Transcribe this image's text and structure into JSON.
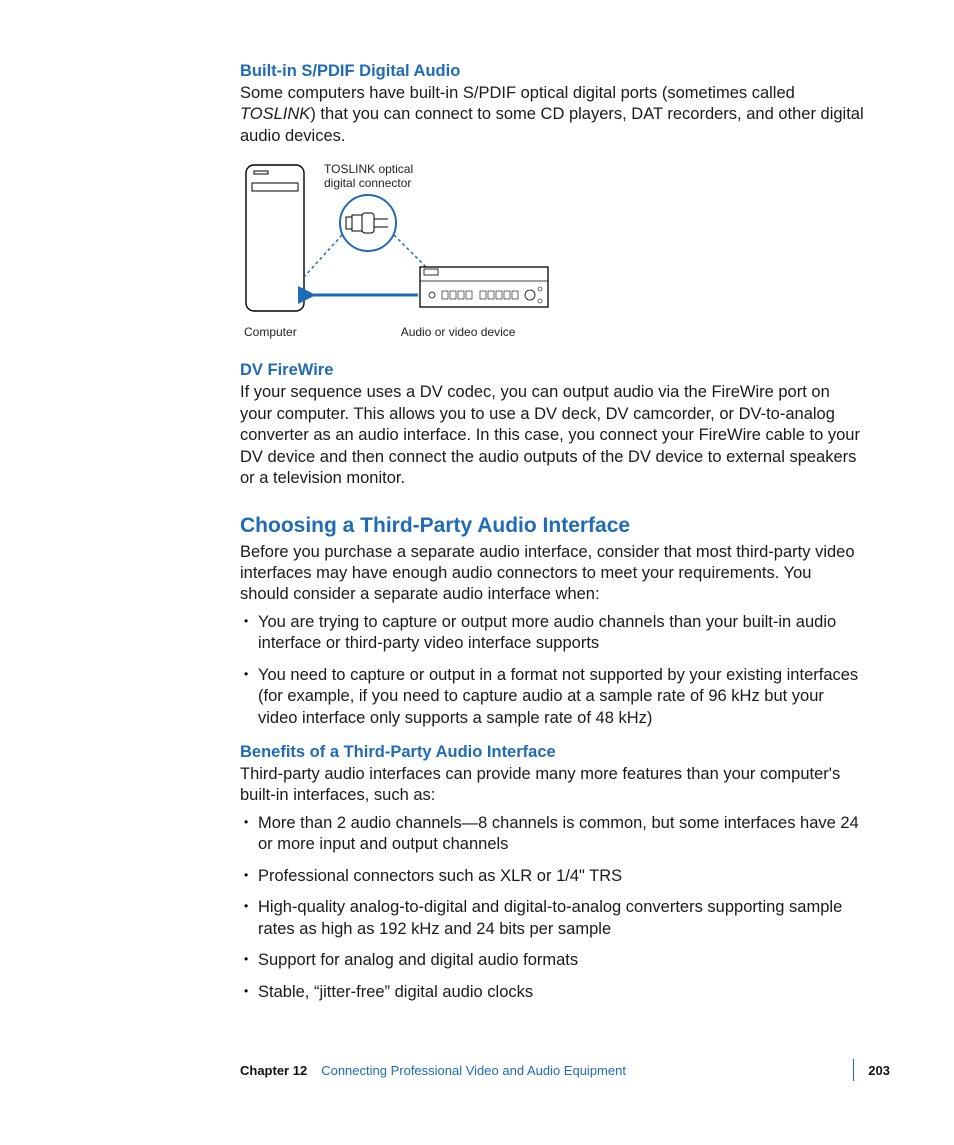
{
  "spdif": {
    "heading": "Built-in S/PDIF Digital Audio",
    "body_a": "Some computers have built-in S/PDIF optical digital ports (sometimes called ",
    "body_em": "TOSLINK",
    "body_b": ") that you can connect to some CD players, DAT recorders, and other digital audio devices."
  },
  "diagram": {
    "callout1": "TOSLINK optical",
    "callout2": "digital connector",
    "left_caption": "Computer",
    "right_caption": "Audio or video device"
  },
  "firewire": {
    "heading": "DV FireWire",
    "body": "If your sequence uses a DV codec, you can output audio via the FireWire port on your computer. This allows you to use a DV deck, DV camcorder, or DV-to-analog converter as an audio interface. In this case, you connect your FireWire cable to your DV device and then connect the audio outputs of the DV device to external speakers or a television monitor."
  },
  "choosing": {
    "title": "Choosing a Third-Party Audio Interface",
    "intro": "Before you purchase a separate audio interface, consider that most third-party video interfaces may have enough audio connectors to meet your requirements. You should consider a separate audio interface when:",
    "bullets": [
      "You are trying to capture or output more audio channels than your built-in audio interface or third-party video interface supports",
      "You need to capture or output in a format not supported by your existing interfaces (for example, if you need to capture audio at a sample rate of 96 kHz but your video interface only supports a sample rate of 48 kHz)"
    ]
  },
  "benefits": {
    "heading": "Benefits of a Third-Party Audio Interface",
    "intro": "Third-party audio interfaces can provide many more features than your computer's built-in interfaces, such as:",
    "bullets": [
      "More than 2 audio channels—8 channels is common, but some interfaces have 24 or more input and output channels",
      "Professional connectors such as XLR or 1/4\" TRS",
      "High-quality analog-to-digital and digital-to-analog converters supporting sample rates as high as 192 kHz and 24 bits per sample",
      "Support for analog and digital audio formats",
      "Stable, “jitter-free” digital audio clocks"
    ]
  },
  "footer": {
    "chapter_label": "Chapter 12",
    "chapter_title": "Connecting Professional Video and Audio Equipment",
    "page": "203"
  }
}
